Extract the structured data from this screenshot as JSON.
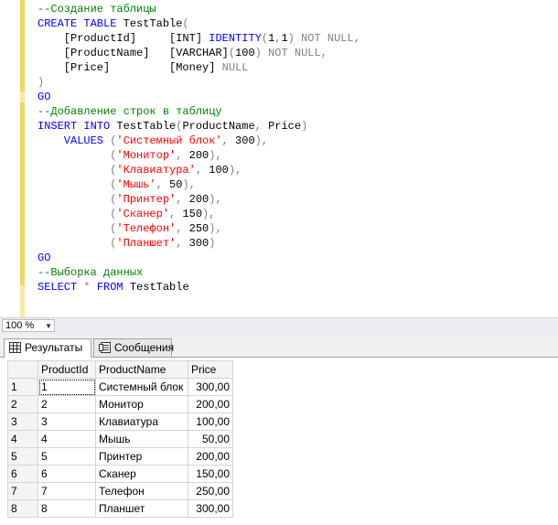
{
  "editor": {
    "lines": [
      [
        {
          "t": "--Создание таблицы",
          "c": "cm"
        }
      ],
      [
        {
          "t": "CREATE TABLE ",
          "c": "kw"
        },
        {
          "t": "TestTable",
          "c": "bk"
        },
        {
          "t": "(",
          "c": "gy"
        }
      ],
      [
        {
          "t": "    [ProductId]     ",
          "c": "bk"
        },
        {
          "t": "[INT] ",
          "c": "bk"
        },
        {
          "t": "IDENTITY",
          "c": "kw"
        },
        {
          "t": "(",
          "c": "gy"
        },
        {
          "t": "1",
          "c": "bk"
        },
        {
          "t": ",",
          "c": "gy"
        },
        {
          "t": "1",
          "c": "bk"
        },
        {
          "t": ") ",
          "c": "gy"
        },
        {
          "t": "NOT NULL",
          "c": "gy"
        },
        {
          "t": ",",
          "c": "gy"
        }
      ],
      [
        {
          "t": "    [ProductName]   ",
          "c": "bk"
        },
        {
          "t": "[VARCHAR]",
          "c": "bk"
        },
        {
          "t": "(",
          "c": "gy"
        },
        {
          "t": "100",
          "c": "bk"
        },
        {
          "t": ") ",
          "c": "gy"
        },
        {
          "t": "NOT NULL",
          "c": "gy"
        },
        {
          "t": ",",
          "c": "gy"
        }
      ],
      [
        {
          "t": "    [Price]         ",
          "c": "bk"
        },
        {
          "t": "[Money] ",
          "c": "bk"
        },
        {
          "t": "NULL",
          "c": "gy"
        }
      ],
      [
        {
          "t": ")",
          "c": "gy"
        }
      ],
      [
        {
          "t": "GO",
          "c": "kw"
        }
      ],
      [
        {
          "t": "--Добавление строк в таблицу",
          "c": "cm"
        }
      ],
      [
        {
          "t": "INSERT INTO ",
          "c": "kw"
        },
        {
          "t": "TestTable",
          "c": "bk"
        },
        {
          "t": "(",
          "c": "gy"
        },
        {
          "t": "ProductName",
          "c": "bk"
        },
        {
          "t": ", ",
          "c": "gy"
        },
        {
          "t": "Price",
          "c": "bk"
        },
        {
          "t": ")",
          "c": "gy"
        }
      ],
      [
        {
          "t": "    VALUES ",
          "c": "kw"
        },
        {
          "t": "(",
          "c": "gy"
        },
        {
          "t": "'Системный блок'",
          "c": "st"
        },
        {
          "t": ", ",
          "c": "gy"
        },
        {
          "t": "300",
          "c": "bk"
        },
        {
          "t": "),",
          "c": "gy"
        }
      ],
      [
        {
          "t": "           (",
          "c": "gy"
        },
        {
          "t": "'Монитор'",
          "c": "st"
        },
        {
          "t": ", ",
          "c": "gy"
        },
        {
          "t": "200",
          "c": "bk"
        },
        {
          "t": "),",
          "c": "gy"
        }
      ],
      [
        {
          "t": "           (",
          "c": "gy"
        },
        {
          "t": "'Клавиатура'",
          "c": "st"
        },
        {
          "t": ", ",
          "c": "gy"
        },
        {
          "t": "100",
          "c": "bk"
        },
        {
          "t": "),",
          "c": "gy"
        }
      ],
      [
        {
          "t": "           (",
          "c": "gy"
        },
        {
          "t": "'Мышь'",
          "c": "st"
        },
        {
          "t": ", ",
          "c": "gy"
        },
        {
          "t": "50",
          "c": "bk"
        },
        {
          "t": "),",
          "c": "gy"
        }
      ],
      [
        {
          "t": "           (",
          "c": "gy"
        },
        {
          "t": "'Принтер'",
          "c": "st"
        },
        {
          "t": ", ",
          "c": "gy"
        },
        {
          "t": "200",
          "c": "bk"
        },
        {
          "t": "),",
          "c": "gy"
        }
      ],
      [
        {
          "t": "           (",
          "c": "gy"
        },
        {
          "t": "'Сканер'",
          "c": "st"
        },
        {
          "t": ", ",
          "c": "gy"
        },
        {
          "t": "150",
          "c": "bk"
        },
        {
          "t": "),",
          "c": "gy"
        }
      ],
      [
        {
          "t": "           (",
          "c": "gy"
        },
        {
          "t": "'Телефон'",
          "c": "st"
        },
        {
          "t": ", ",
          "c": "gy"
        },
        {
          "t": "250",
          "c": "bk"
        },
        {
          "t": "),",
          "c": "gy"
        }
      ],
      [
        {
          "t": "           (",
          "c": "gy"
        },
        {
          "t": "'Планшет'",
          "c": "st"
        },
        {
          "t": ", ",
          "c": "gy"
        },
        {
          "t": "300",
          "c": "bk"
        },
        {
          "t": ")",
          "c": "gy"
        }
      ],
      [
        {
          "t": "GO",
          "c": "kw"
        }
      ],
      [
        {
          "t": "--Выборка данных",
          "c": "cm"
        }
      ],
      [
        {
          "t": "SELECT ",
          "c": "kw"
        },
        {
          "t": "* ",
          "c": "gy"
        },
        {
          "t": "FROM ",
          "c": "kw"
        },
        {
          "t": "TestTable",
          "c": "bk"
        }
      ]
    ]
  },
  "zoom": {
    "value": "100 %"
  },
  "tabs": [
    {
      "label": "Результаты",
      "icon": "grid-icon",
      "active": true
    },
    {
      "label": "Сообщения",
      "icon": "messages-icon",
      "active": false
    }
  ],
  "grid": {
    "columns": [
      "ProductId",
      "ProductName",
      "Price"
    ],
    "rows": [
      {
        "n": "1",
        "id": "1",
        "name": "Системный блок",
        "price": "300,00"
      },
      {
        "n": "2",
        "id": "2",
        "name": "Монитор",
        "price": "200,00"
      },
      {
        "n": "3",
        "id": "3",
        "name": "Клавиатура",
        "price": "100,00"
      },
      {
        "n": "4",
        "id": "4",
        "name": "Мышь",
        "price": "50,00"
      },
      {
        "n": "5",
        "id": "5",
        "name": "Принтер",
        "price": "200,00"
      },
      {
        "n": "6",
        "id": "6",
        "name": "Сканер",
        "price": "150,00"
      },
      {
        "n": "7",
        "id": "7",
        "name": "Телефон",
        "price": "250,00"
      },
      {
        "n": "8",
        "id": "8",
        "name": "Планшет",
        "price": "300,00"
      }
    ]
  },
  "colors": {
    "keyword": "#0000ff",
    "comment": "#008000",
    "string": "#ff0000",
    "operator": "#808080",
    "change_bar": "#f0d75e"
  }
}
